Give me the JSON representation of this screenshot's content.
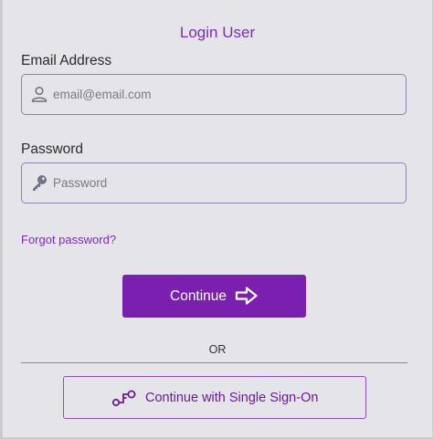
{
  "form": {
    "title": "Login User",
    "email": {
      "label": "Email Address",
      "placeholder": "email@email.com",
      "value": "",
      "icon": "user-icon"
    },
    "password": {
      "label": "Password",
      "placeholder": "Password",
      "value": "",
      "icon": "key-icon"
    },
    "forgot_label": "Forgot password?",
    "continue_label": "Continue",
    "continue_icon": "arrow-right-icon",
    "or_label": "OR",
    "sso_label": "Continue with Single Sign-On",
    "sso_icon": "sso-key-icon"
  },
  "colors": {
    "accent": "#7b2cbf",
    "button_bg": "#7b1fb0",
    "background": "#e5e4e8",
    "border": "#8a82b0"
  }
}
